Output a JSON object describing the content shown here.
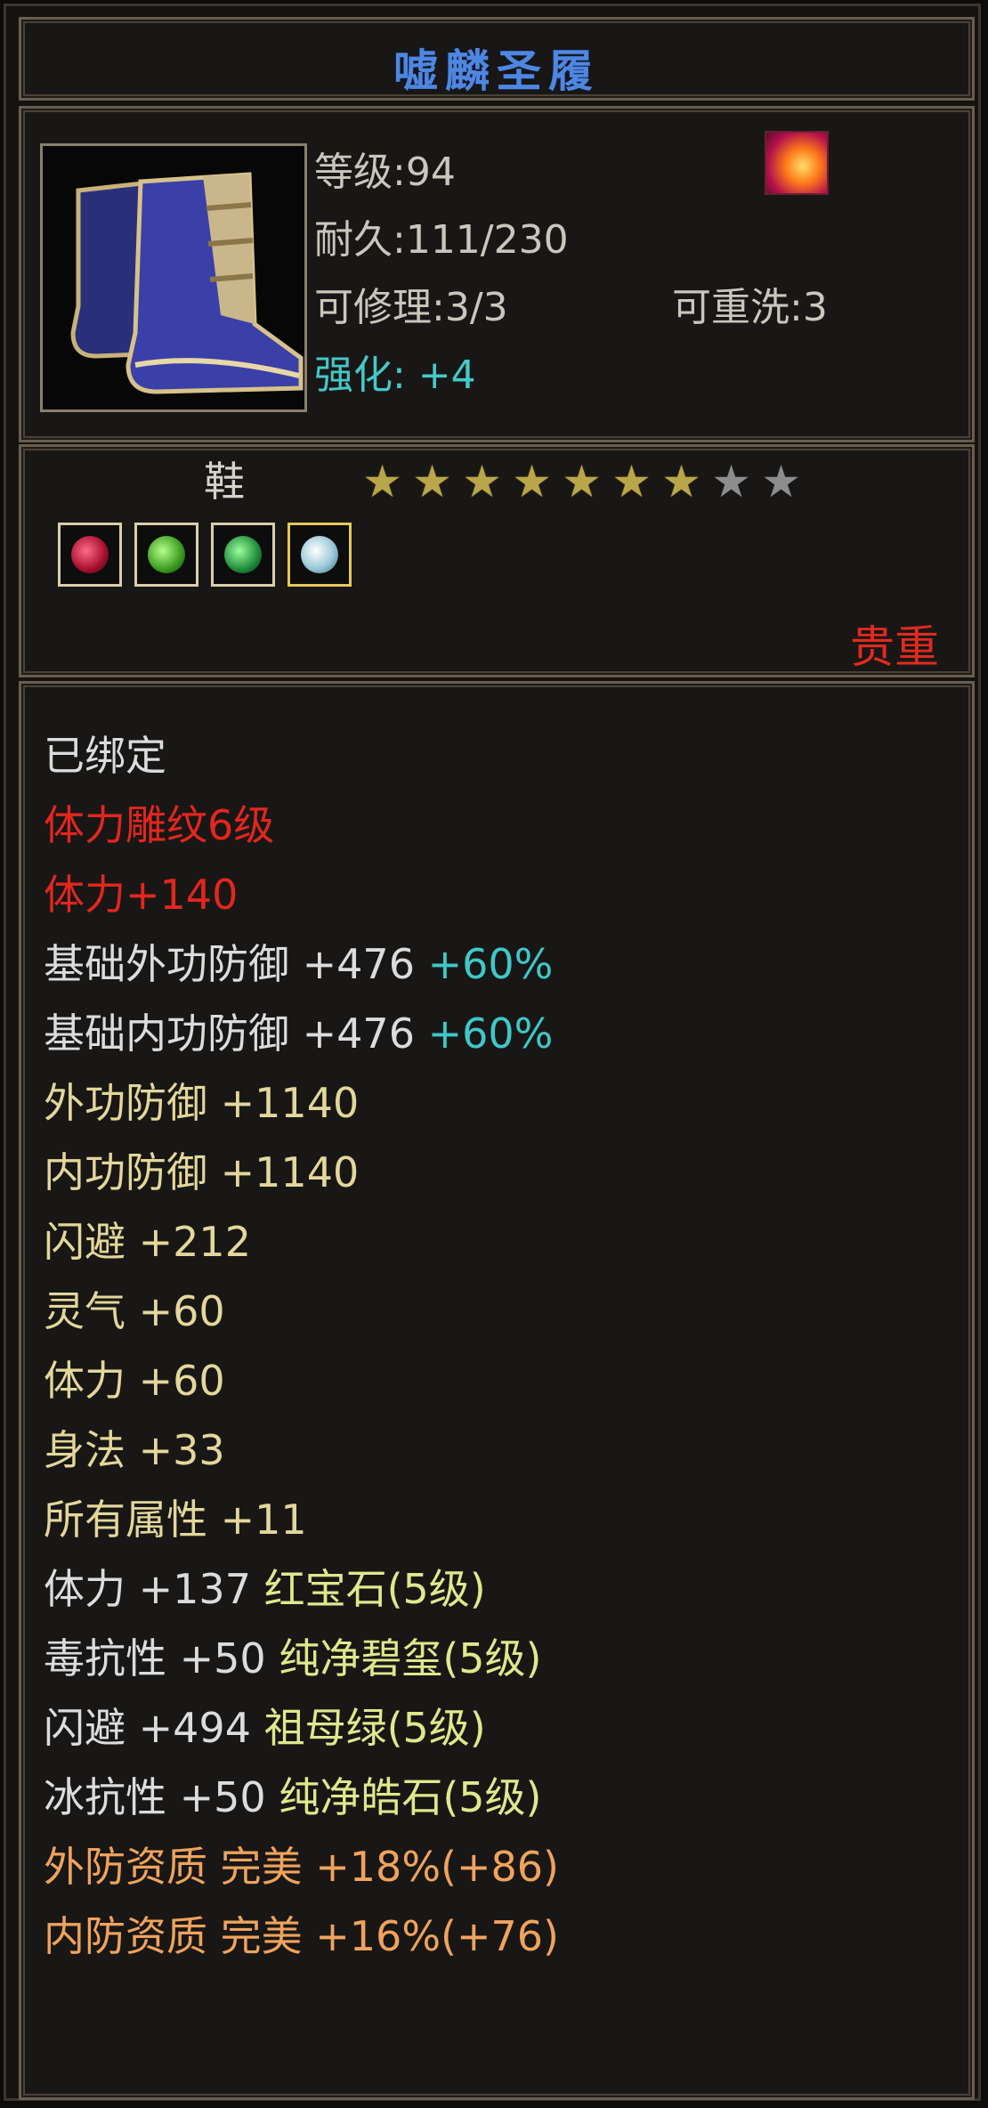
{
  "item": {
    "name": "嘘麟圣履",
    "level_line": "等级:94",
    "durability_line": "耐久:111/230",
    "repair_line": "可修理:3/3",
    "rewash_line": "可重洗:3",
    "enhance_line": "强化: +4",
    "type": "鞋",
    "rarity": "贵重",
    "stars": {
      "filled": 7,
      "total": 9
    },
    "gem_slots": [
      "red-gem-icon",
      "green-gem-icon",
      "jade-gem-icon",
      "white-gem-icon"
    ]
  },
  "attributes": {
    "bound": "已绑定",
    "engraving": "体力雕纹6级",
    "engraving_bonus": "体力+140",
    "base_outer_def": {
      "label": "基础外功防御 +476",
      "extra": "+60%"
    },
    "base_inner_def": {
      "label": "基础内功防御 +476",
      "extra": "+60%"
    },
    "outer_def": "外功防御 +1140",
    "inner_def": "内功防御 +1140",
    "dodge": "闪避 +212",
    "spirit": "灵气 +60",
    "stamina": "体力 +60",
    "agility": "身法 +33",
    "all_attr": "所有属性 +11",
    "gem1": {
      "stat": "体力 +137",
      "gem": "红宝石(5级)"
    },
    "gem2": {
      "stat": "毒抗性 +50",
      "gem": "纯净碧玺(5级)"
    },
    "gem3": {
      "stat": "闪避 +494",
      "gem": "祖母绿(5级)"
    },
    "gem4": {
      "stat": "冰抗性 +50",
      "gem": "纯净皓石(5级)"
    },
    "quality1": "外防资质  完美 +18%(+86)",
    "quality2": "内防资质  完美 +16%(+76)"
  },
  "colors": {
    "title": "#4f86e0",
    "enhance": "#45c9c9",
    "rarity": "#e12a1f",
    "engraving": "#e3261e",
    "stats": "#e3d79a",
    "quality": "#f0a35c",
    "gem_text": "#dfe88c",
    "bound": "#dcdcdc",
    "bonus_percent": "#3fc8c8"
  }
}
